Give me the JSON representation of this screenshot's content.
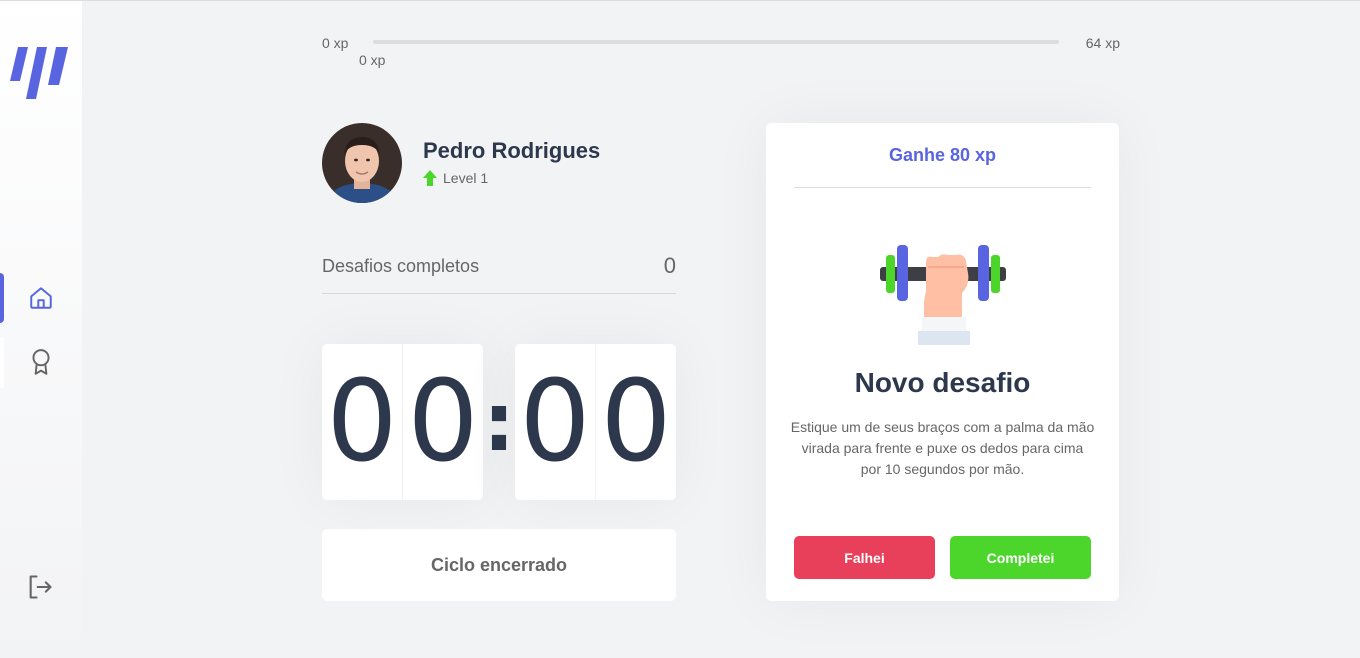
{
  "sidebar": {
    "items": [
      {
        "icon": "home-icon",
        "active": true
      },
      {
        "icon": "award-icon",
        "active": false
      }
    ],
    "logout_icon": "logout-icon"
  },
  "xp": {
    "min_label": "0 xp",
    "max_label": "64 xp",
    "current_label": "0 xp",
    "progress_percent": 0
  },
  "profile": {
    "name": "Pedro Rodrigues",
    "level_label": "Level 1"
  },
  "challenges": {
    "label": "Desafios completos",
    "count": "0"
  },
  "countdown": {
    "minute_left": "0",
    "minute_right": "0",
    "separator": ":",
    "second_left": "0",
    "second_right": "0"
  },
  "cycle_button": "Ciclo encerrado",
  "challenge_card": {
    "header": "Ganhe 80 xp",
    "icon": "dumbbell-icon",
    "title": "Novo desafio",
    "description": "Estique um de seus braços com a palma da mão virada para frente e puxe os dedos para cima por 10 segundos por mão.",
    "fail_button": "Falhei",
    "complete_button": "Completei"
  },
  "colors": {
    "accent": "#5965e0",
    "success": "#4cd62b",
    "danger": "#e83f5b",
    "title": "#2e384d",
    "text": "#666666",
    "background": "#f2f3f5"
  }
}
